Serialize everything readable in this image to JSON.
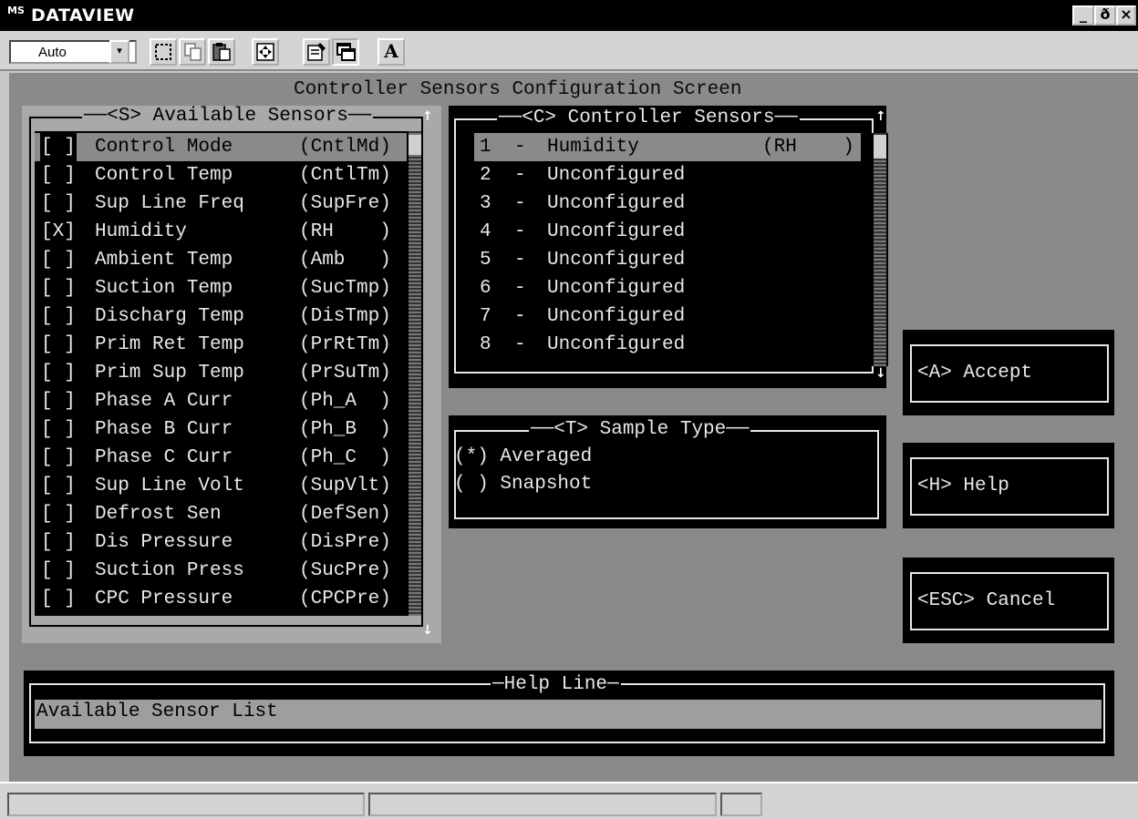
{
  "window": {
    "icon_text": "MS",
    "title": "DATAVIEW",
    "controls": [
      "_",
      "ð",
      "×"
    ]
  },
  "toolbar": {
    "font_select_value": "Auto",
    "font_select_arrow": "▾",
    "text_button_label": "A"
  },
  "screen": {
    "title": "Controller Sensors Configuration Screen"
  },
  "available_sensors": {
    "title": "<S> Available Sensors",
    "items": [
      {
        "mark": "[ ]",
        "name": "Control Mode",
        "code": "(CntlMd)",
        "selected": true
      },
      {
        "mark": "[ ]",
        "name": "Control Temp",
        "code": "(CntlTm)"
      },
      {
        "mark": "[ ]",
        "name": "Sup Line Freq",
        "code": "(SupFre)"
      },
      {
        "mark": "[X]",
        "name": "Humidity",
        "code": "(RH    )"
      },
      {
        "mark": "[ ]",
        "name": "Ambient Temp",
        "code": "(Amb   )"
      },
      {
        "mark": "[ ]",
        "name": "Suction Temp",
        "code": "(SucTmp)"
      },
      {
        "mark": "[ ]",
        "name": "Discharg Temp",
        "code": "(DisTmp)"
      },
      {
        "mark": "[ ]",
        "name": "Prim Ret Temp",
        "code": "(PrRtTm)"
      },
      {
        "mark": "[ ]",
        "name": "Prim Sup Temp",
        "code": "(PrSuTm)"
      },
      {
        "mark": "[ ]",
        "name": "Phase A Curr",
        "code": "(Ph_A  )"
      },
      {
        "mark": "[ ]",
        "name": "Phase B Curr",
        "code": "(Ph_B  )"
      },
      {
        "mark": "[ ]",
        "name": "Phase C Curr",
        "code": "(Ph_C  )"
      },
      {
        "mark": "[ ]",
        "name": "Sup Line Volt",
        "code": "(SupVlt)"
      },
      {
        "mark": "[ ]",
        "name": "Defrost Sen",
        "code": "(DefSen)"
      },
      {
        "mark": "[ ]",
        "name": "Dis Pressure",
        "code": "(DisPre)"
      },
      {
        "mark": "[ ]",
        "name": "Suction Press",
        "code": "(SucPre)"
      },
      {
        "mark": "[ ]",
        "name": "CPC Pressure",
        "code": "(CPCPre)"
      }
    ]
  },
  "controller_sensors": {
    "title": "<C> Controller Sensors",
    "items": [
      {
        "num": "1",
        "name": "Humidity",
        "code": "(RH    )",
        "selected": true
      },
      {
        "num": "2",
        "name": "Unconfigured",
        "code": ""
      },
      {
        "num": "3",
        "name": "Unconfigured",
        "code": ""
      },
      {
        "num": "4",
        "name": "Unconfigured",
        "code": ""
      },
      {
        "num": "5",
        "name": "Unconfigured",
        "code": ""
      },
      {
        "num": "6",
        "name": "Unconfigured",
        "code": ""
      },
      {
        "num": "7",
        "name": "Unconfigured",
        "code": ""
      },
      {
        "num": "8",
        "name": "Unconfigured",
        "code": ""
      }
    ]
  },
  "sample_type": {
    "title": "<T> Sample Type",
    "options": [
      {
        "mark": "(*)",
        "label": "Averaged"
      },
      {
        "mark": "( )",
        "label": "Snapshot"
      }
    ]
  },
  "buttons": {
    "accept": "<A> Accept",
    "help": "<H> Help",
    "cancel": "<ESC> Cancel"
  },
  "help_line": {
    "title": "Help Line",
    "text": "Available Sensor List"
  },
  "scroll": {
    "up": "↑",
    "down": "↓"
  }
}
